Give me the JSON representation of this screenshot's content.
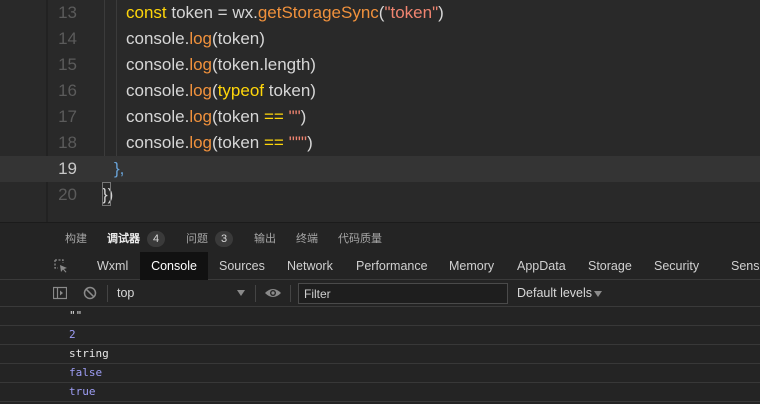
{
  "editor": {
    "lines": [
      {
        "num": "13",
        "tokens": [
          [
            "kw",
            "const"
          ],
          [
            "plain",
            " token = wx."
          ],
          [
            "fn",
            "getStorageSync"
          ],
          [
            "plain",
            "("
          ],
          [
            "str",
            "\"token\""
          ],
          [
            "plain",
            ")"
          ]
        ]
      },
      {
        "num": "14",
        "tokens": [
          [
            "plain",
            "console."
          ],
          [
            "fn",
            "log"
          ],
          [
            "plain",
            "(token)"
          ]
        ]
      },
      {
        "num": "15",
        "tokens": [
          [
            "plain",
            "console."
          ],
          [
            "fn",
            "log"
          ],
          [
            "plain",
            "(token.length)"
          ]
        ]
      },
      {
        "num": "16",
        "tokens": [
          [
            "plain",
            "console."
          ],
          [
            "fn",
            "log"
          ],
          [
            "plain",
            "("
          ],
          [
            "kw",
            "typeof"
          ],
          [
            "plain",
            " token)"
          ]
        ]
      },
      {
        "num": "17",
        "tokens": [
          [
            "plain",
            "console."
          ],
          [
            "fn",
            "log"
          ],
          [
            "plain",
            "(token "
          ],
          [
            "kw",
            "=="
          ],
          [
            "plain",
            " "
          ],
          [
            "str",
            "\"\""
          ],
          [
            "plain",
            ")"
          ]
        ]
      },
      {
        "num": "18",
        "tokens": [
          [
            "plain",
            "console."
          ],
          [
            "fn",
            "log"
          ],
          [
            "plain",
            "(token "
          ],
          [
            "kw",
            "=="
          ],
          [
            "plain",
            " "
          ],
          [
            "str",
            "'\"\"'"
          ],
          [
            "plain",
            ")"
          ]
        ]
      },
      {
        "num": "19",
        "tokens": [
          [
            "punc",
            "},"
          ]
        ]
      },
      {
        "num": "20",
        "tokens": [
          [
            "plain",
            "})"
          ]
        ]
      }
    ]
  },
  "panel_tabs": {
    "build": "构建",
    "debugger": "调试器",
    "debugger_count": "4",
    "issues": "问题",
    "issues_count": "3",
    "output": "输出",
    "terminal": "终端",
    "code_quality": "代码质量"
  },
  "devtools_tabs": [
    "Wxml",
    "Console",
    "Sources",
    "Network",
    "Performance",
    "Memory",
    "AppData",
    "Storage",
    "Security",
    "Sensor"
  ],
  "console_toolbar": {
    "context": "top",
    "filter_placeholder": "Filter",
    "levels": "Default levels"
  },
  "console_output": [
    {
      "text": "\"\"",
      "kind": "str"
    },
    {
      "text": "2",
      "kind": "num"
    },
    {
      "text": "string",
      "kind": "str"
    },
    {
      "text": "false",
      "kind": "bool"
    },
    {
      "text": "true",
      "kind": "bool"
    }
  ]
}
